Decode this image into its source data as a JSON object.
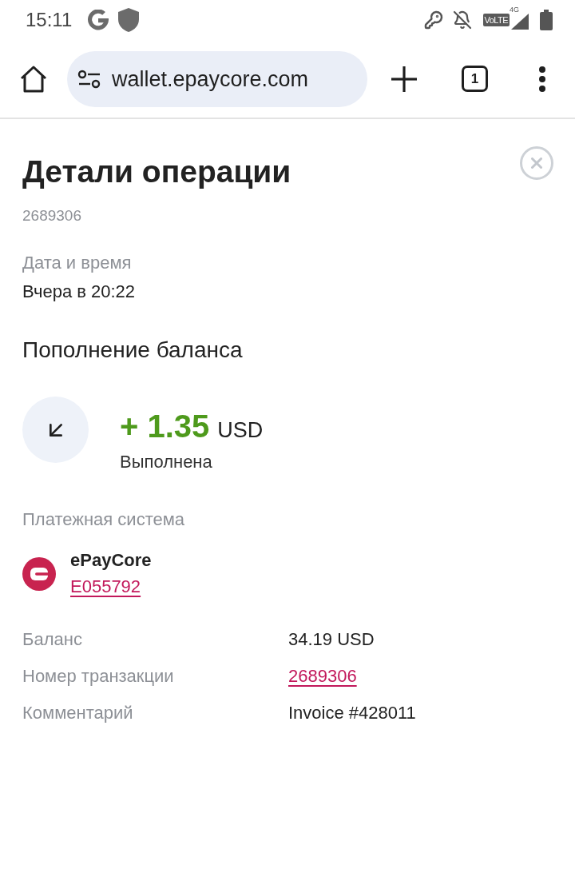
{
  "status_bar": {
    "time": "15:11",
    "volte": "VoLTE",
    "network": "4G"
  },
  "browser": {
    "url": "wallet.epaycore.com",
    "tab_count": "1"
  },
  "header": {
    "title": "Детали операции",
    "id": "2689306"
  },
  "date": {
    "label": "Дата и время",
    "value": "Вчера в 20:22"
  },
  "operation": {
    "type": "Пополнение баланса",
    "incoming": true,
    "amount": "+ 1.35",
    "currency": "USD",
    "status": "Выполнена"
  },
  "payment_system": {
    "label": "Платежная система",
    "name": "ePayCore",
    "account": "E055792"
  },
  "details": [
    {
      "label": "Баланс",
      "value": "34.19 USD",
      "kind": "text"
    },
    {
      "label": "Номер транзакции",
      "value": "2689306",
      "kind": "link"
    },
    {
      "label": "Комментарий",
      "value": "Invoice #428011",
      "kind": "text"
    }
  ]
}
